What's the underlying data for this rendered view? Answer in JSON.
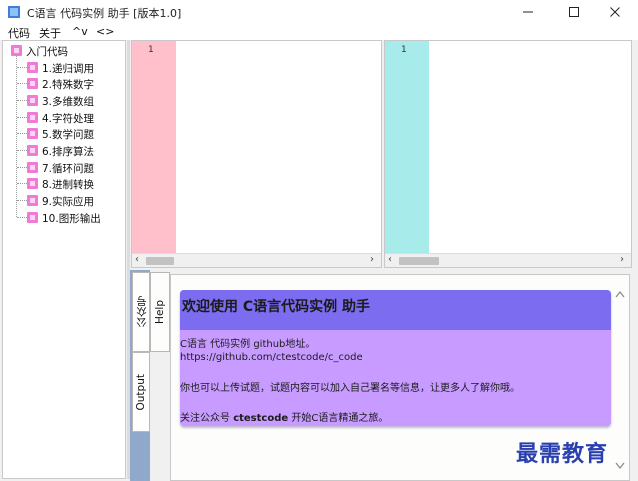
{
  "window": {
    "title": "C语言 代码实例 助手 [版本1.0]",
    "app_icon": "app-icon",
    "controls": [
      "minimize-icon",
      "maximize-icon",
      "close-icon"
    ]
  },
  "menu": {
    "items": [
      "代码",
      "关于",
      "^v",
      "<>"
    ]
  },
  "tree": {
    "root": "入门代码",
    "children": [
      "1.递归调用",
      "2.特殊数字",
      "3.多维数组",
      "4.字符处理",
      "5.数学问题",
      "6.排序算法",
      "7.循环问题",
      "8.进制转换",
      "9.实际应用",
      "10.图形输出"
    ]
  },
  "editors": {
    "left": {
      "line": "1",
      "gutter_color": "#ffc0cb"
    },
    "right": {
      "line": "1",
      "gutter_color": "#a8ebeb"
    }
  },
  "dock": {
    "tabs": [
      "公众号",
      "Help",
      "Output"
    ]
  },
  "help": {
    "title": "欢迎使用 C语言代码实例 助手",
    "line1": "C语言 代码实例 github地址。",
    "line2": "https://github.com/ctestcode/c_code",
    "line3": "你也可以上传试题，试题内容可以加入自己署名等信息，让更多人了解你哦。",
    "line4_pre": "关注公众号 ",
    "line4_bold": "ctestcode",
    "line4_post": " 开始C语言精通之旅。",
    "header_color": "#7b6cf0",
    "body_color": "#c79bff"
  },
  "watermark": "最需教育"
}
